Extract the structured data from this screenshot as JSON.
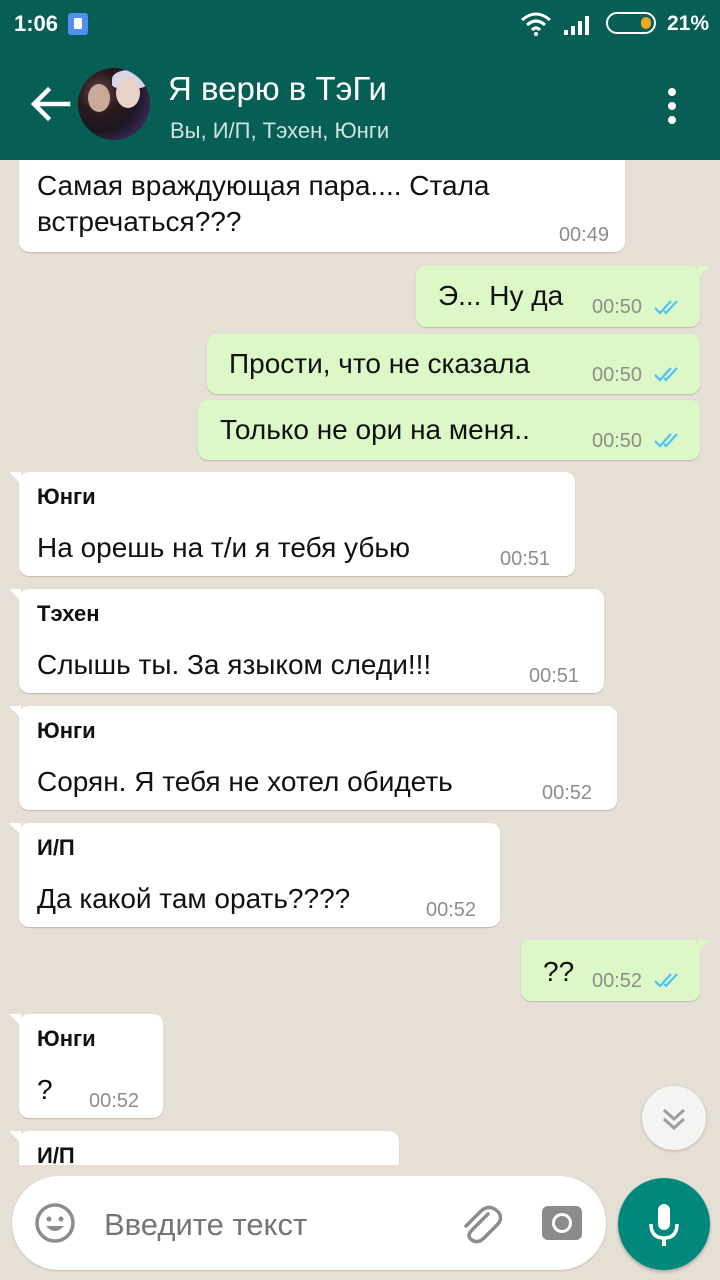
{
  "status_bar": {
    "time": "1:06",
    "battery": "21%"
  },
  "header": {
    "title": "Я верю в ТэГи",
    "subtitle": "Вы, И/П, Тэхен, Юнги"
  },
  "messages": [
    {
      "dir": "in",
      "sender": "",
      "text1": "Самая враждующая пара.... Стала",
      "text2": "встречаться???",
      "time": "00:49"
    },
    {
      "dir": "out",
      "text": "Э... Ну да",
      "time": "00:50"
    },
    {
      "dir": "out",
      "text": "Прости, что не сказала",
      "time": "00:50"
    },
    {
      "dir": "out",
      "text": "Только не ори на меня..",
      "time": "00:50"
    },
    {
      "dir": "in",
      "sender": "Юнги",
      "text": "На орешь на т/и я тебя убью",
      "time": "00:51"
    },
    {
      "dir": "in",
      "sender": "Тэхен",
      "text": "Слышь ты. За языком следи!!!",
      "time": "00:51"
    },
    {
      "dir": "in",
      "sender": "Юнги",
      "text": "Сорян. Я тебя не хотел обидеть",
      "time": "00:52"
    },
    {
      "dir": "in",
      "sender": "И/П",
      "text": "Да какой там орать????",
      "time": "00:52"
    },
    {
      "dir": "out",
      "text": "??",
      "time": "00:52"
    },
    {
      "dir": "in",
      "sender": "Юнги",
      "text": "?",
      "time": "00:52"
    },
    {
      "dir": "in",
      "sender": "И/П",
      "text": "",
      "time": ""
    }
  ],
  "input": {
    "placeholder": "Введите текст"
  },
  "colors": {
    "header": "#075e54",
    "outgoing": "#dcf8c6",
    "incoming": "#ffffff",
    "ticks": "#4fc3f7",
    "mic": "#00897b"
  },
  "icons": [
    "back-arrow-icon",
    "more-vert-icon",
    "emoji-icon",
    "attach-icon",
    "camera-icon",
    "mic-icon",
    "chevron-down-icon",
    "double-check-icon"
  ]
}
